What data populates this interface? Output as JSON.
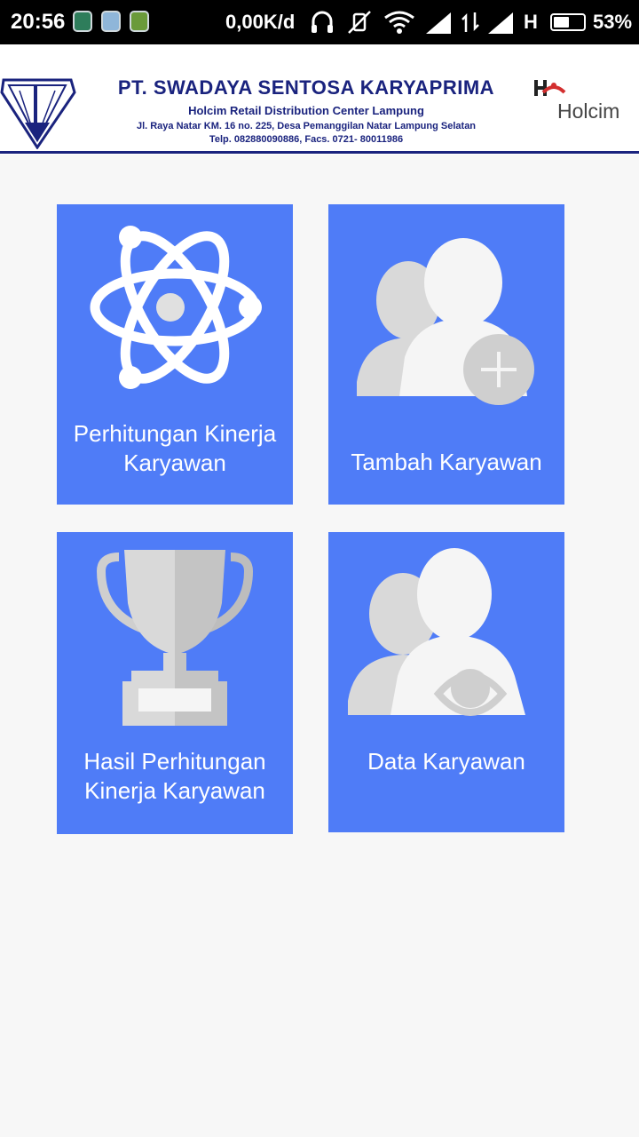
{
  "status_bar": {
    "time": "20:56",
    "network_speed": "0,00K/d",
    "network_type": "H",
    "battery_percent": "53%",
    "battery_level": 0.53
  },
  "header": {
    "company_name": "PT. SWADAYA SENTOSA KARYAPRIMA",
    "subtitle": "Holcim Retail Distribution Center Lampung",
    "address": "Jl. Raya Natar KM. 16 no. 225, Desa Pemanggilan Natar Lampung Selatan",
    "phone": "Telp. 082880090886, Facs. 0721- 80011986",
    "brand": "Holcim",
    "rule_color": "#1a237e"
  },
  "menu": {
    "tile_color": "#4f7cf7",
    "items": [
      {
        "label": "Perhitungan Kinerja Karyawan",
        "icon": "atom-icon"
      },
      {
        "label": "Tambah Karyawan",
        "icon": "add-user-icon"
      },
      {
        "label": "Hasil Perhitungan Kinerja Karyawan",
        "icon": "trophy-icon"
      },
      {
        "label": "Data Karyawan",
        "icon": "view-users-icon"
      }
    ]
  }
}
